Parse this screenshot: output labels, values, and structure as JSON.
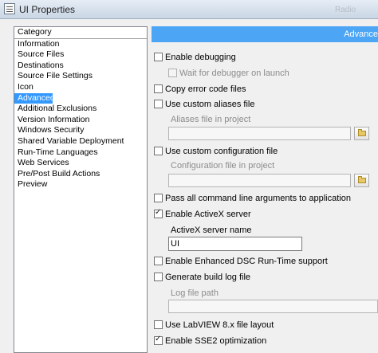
{
  "window": {
    "title": "UI Properties",
    "background_label": "Radio"
  },
  "sidebar": {
    "items": [
      {
        "label": "Category",
        "header": true
      },
      {
        "label": "Information"
      },
      {
        "label": "Source Files"
      },
      {
        "label": "Destinations"
      },
      {
        "label": "Source File Settings"
      },
      {
        "label": "Icon"
      },
      {
        "label": "Advanced",
        "selected": true
      },
      {
        "label": "Additional Exclusions"
      },
      {
        "label": "Version Information"
      },
      {
        "label": "Windows Security"
      },
      {
        "label": "Shared Variable Deployment"
      },
      {
        "label": "Run-Time Languages"
      },
      {
        "label": "Web Services"
      },
      {
        "label": "Pre/Post Build Actions"
      },
      {
        "label": "Preview"
      }
    ]
  },
  "header": {
    "title": "Advance",
    "color": "#4da6f5"
  },
  "options": {
    "enable_debugging": {
      "label": "Enable debugging",
      "checked": false
    },
    "wait_for_debugger": {
      "label": "Wait for debugger on launch",
      "checked": false,
      "disabled": true
    },
    "copy_error_code_files": {
      "label": "Copy error code files",
      "checked": false
    },
    "use_custom_aliases": {
      "label": "Use custom aliases file",
      "checked": false
    },
    "aliases_file_label": "Aliases file in project",
    "use_custom_config": {
      "label": "Use custom configuration file",
      "checked": false
    },
    "config_file_label": "Configuration file in project",
    "pass_all_args": {
      "label": "Pass all command line arguments to application",
      "checked": false
    },
    "enable_activex": {
      "label": "Enable ActiveX server",
      "checked": true
    },
    "activex_name_label": "ActiveX server name",
    "activex_name_value": "UI",
    "enhanced_dsc": {
      "label": "Enable Enhanced DSC Run-Time support",
      "checked": false
    },
    "build_log": {
      "label": "Generate build log file",
      "checked": false
    },
    "log_file_label": "Log file path",
    "labview_8x_layout": {
      "label": "Use LabVIEW 8.x file layout",
      "checked": false
    },
    "sse2": {
      "label": "Enable SSE2 optimization",
      "checked": true
    }
  },
  "icons": {
    "app": "window-icon",
    "browse": "folder-icon"
  }
}
